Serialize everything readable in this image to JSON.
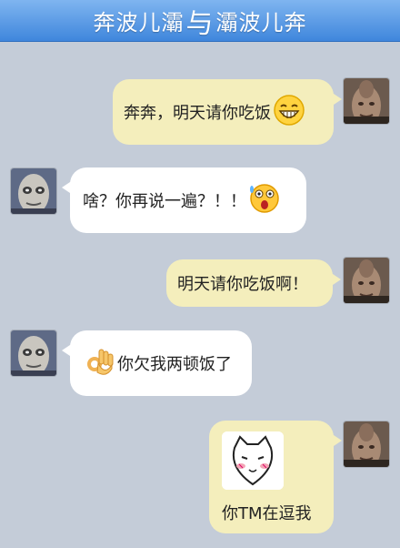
{
  "title": {
    "left": "奔波儿灞",
    "connector": "与",
    "right": "灞波儿奔"
  },
  "messages": [
    {
      "sender": "me",
      "text": "奔奔，明天请你吃饭",
      "emoji": "grinning-face-icon"
    },
    {
      "sender": "other",
      "text": "啥？你再说一遍？！！",
      "emoji": "shocked-face-icon"
    },
    {
      "sender": "me",
      "text": "明天请你吃饭啊！"
    },
    {
      "sender": "other",
      "text": "你欠我两顿饭了",
      "emoji": "ok-hand-icon"
    },
    {
      "sender": "me",
      "text": "你TM在逗我",
      "sticker": "blushing-face-sticker"
    }
  ],
  "colors": {
    "titlebar": "#4a8fe0",
    "background": "#c4ccd8",
    "my_bubble": "#f4eebc",
    "other_bubble": "#ffffff"
  }
}
